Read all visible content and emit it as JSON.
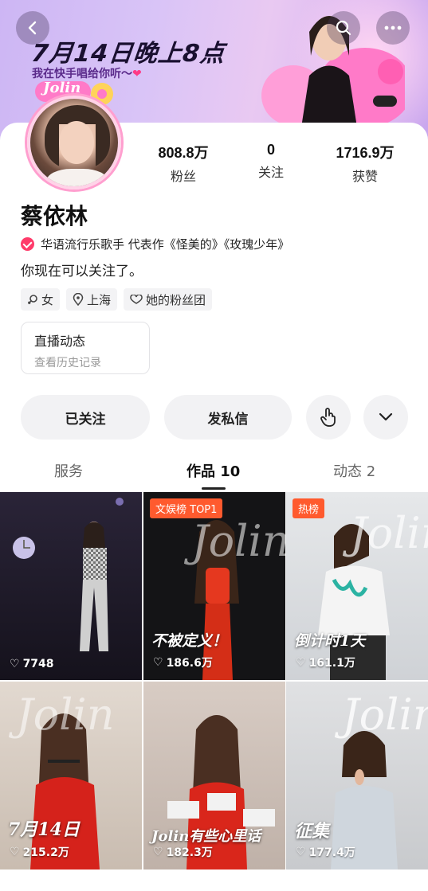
{
  "banner": {
    "title": "7月14日晚上8点",
    "subtitle": "我在快手唱给你听～",
    "sticker_text": "Jolin"
  },
  "profile": {
    "name": "蔡依林",
    "verified_text": "华语流行乐歌手 代表作《怪美的》《玫瑰少年》",
    "bio": "你现在可以关注了。",
    "stats": [
      {
        "value": "808.8万",
        "label": "粉丝"
      },
      {
        "value": "0",
        "label": "关注"
      },
      {
        "value": "1716.9万",
        "label": "获赞"
      }
    ],
    "tags": [
      {
        "icon": "female-icon",
        "label": "女"
      },
      {
        "icon": "location-icon",
        "label": "上海"
      },
      {
        "icon": "fan-club-icon",
        "label": "她的粉丝团"
      }
    ],
    "live": {
      "title": "直播动态",
      "subtitle": "查看历史记录"
    }
  },
  "actions": {
    "follow_label": "已关注",
    "message_label": "发私信"
  },
  "tabs": [
    {
      "label": "服务"
    },
    {
      "label": "作品 10"
    },
    {
      "label": "动态 2"
    }
  ],
  "posts": [
    {
      "likes": "7748",
      "badge": "",
      "caption": "",
      "bg": "#1a1722"
    },
    {
      "likes": "186.6万",
      "badge": "文娱榜 TOP1",
      "caption": "不被定义！",
      "bg": "#151517"
    },
    {
      "likes": "161.1万",
      "badge": "热榜",
      "caption": "倒计时1天",
      "bg": "#dfe1e4"
    },
    {
      "likes": "215.2万",
      "badge": "",
      "caption": "7月14日",
      "bg": "#d9cfc6"
    },
    {
      "likes": "182.3万",
      "badge": "",
      "caption": "Jolin有些心里话",
      "bg": "#cfc3bb"
    },
    {
      "likes": "177.4万",
      "badge": "",
      "caption": "征集",
      "bg": "#d8d9dc"
    }
  ],
  "colors": {
    "accent": "#ff3b6a",
    "badge": "#ff5a2e"
  }
}
